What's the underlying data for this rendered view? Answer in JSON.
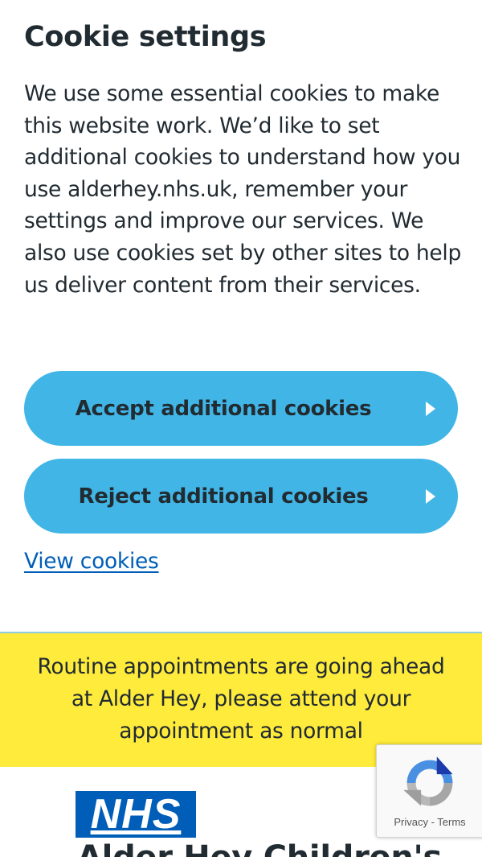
{
  "cookie_banner": {
    "title": "Cookie settings",
    "description": "We use some essential cookies to make this website work. We’d like to set additional cookies to understand how you use alderhey.nhs.uk, remember your settings and improve our services. We also use cookies set by other sites to help us deliver content from their services.",
    "accept_label": "Accept additional cookies",
    "reject_label": "Reject additional cookies",
    "view_cookies_label": "View cookies"
  },
  "alert": {
    "message": "Routine appointments are going ahead at Alder Hey, please attend your appointment as normal"
  },
  "header": {
    "logo_text": "NHS",
    "org_name": "Alder Hey Children's"
  },
  "recaptcha": {
    "privacy_label": "Privacy",
    "separator": " - ",
    "terms_label": "Terms"
  },
  "colors": {
    "button_blue": "#41b6e6",
    "link_blue": "#005eb8",
    "alert_yellow": "#ffeb3b",
    "nhs_blue": "#005eb8",
    "text": "#212b32"
  }
}
